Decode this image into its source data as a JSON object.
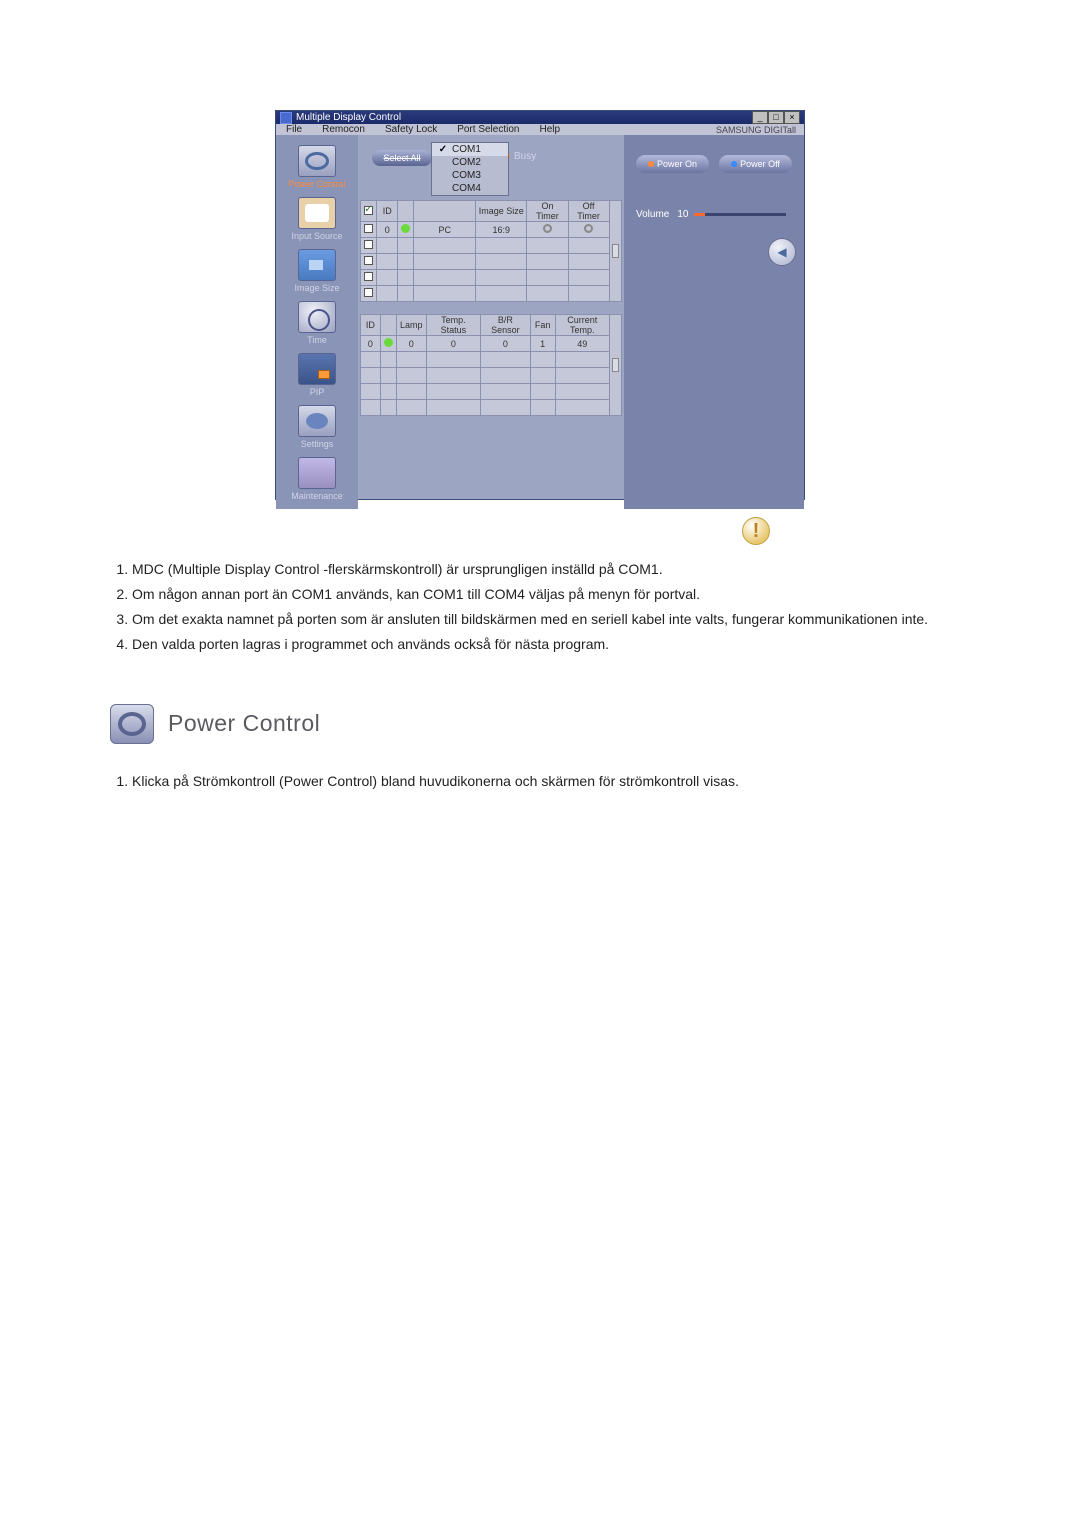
{
  "app": {
    "title": "Multiple Display Control",
    "brand": "SAMSUNG DIGITall",
    "menu": {
      "file": "File",
      "remocon": "Remocon",
      "safety_lock": "Safety Lock",
      "port_selection": "Port Selection",
      "help": "Help"
    },
    "port_menu": [
      "COM1",
      "COM2",
      "COM3",
      "COM4"
    ],
    "port_selected": "COM1",
    "sidebar": [
      {
        "label": "Power Control"
      },
      {
        "label": "Input Source"
      },
      {
        "label": "Image Size"
      },
      {
        "label": "Time"
      },
      {
        "label": "PIP"
      },
      {
        "label": "Settings"
      },
      {
        "label": "Maintenance"
      }
    ],
    "select_all": "Select All",
    "busy_label": "Busy",
    "grid1": {
      "headers": [
        "",
        "ID",
        "",
        "",
        "Image Size",
        "On Timer",
        "Off Timer"
      ],
      "row": {
        "id": "0",
        "source": "PC",
        "image_size": "16:9"
      }
    },
    "grid2": {
      "headers": [
        "ID",
        "",
        "Lamp",
        "Temp. Status",
        "B/R Sensor",
        "Fan",
        "Current Temp."
      ],
      "row": {
        "id": "0",
        "lamp": "0",
        "temp_status": "0",
        "br_sensor": "0",
        "fan": "1",
        "current_temp": "49"
      }
    },
    "right": {
      "power_on": "Power On",
      "power_off": "Power Off",
      "volume_label": "Volume",
      "volume_value": "10"
    }
  },
  "notes_a": [
    "MDC (Multiple Display Control -flerskärmskontroll) är ursprungligen inställd på COM1.",
    "Om någon annan port än COM1 används, kan COM1 till COM4 väljas på menyn för portval.",
    "Om det exakta namnet på porten som är ansluten till bildskärmen med en seriell kabel inte valts, fungerar kommunikationen inte.",
    "Den valda porten lagras i programmet och används också för nästa program."
  ],
  "heading": "Power Control",
  "notes_b": [
    "Klicka på Strömkontroll (Power Control) bland huvudikonerna och skärmen för strömkontroll visas."
  ]
}
